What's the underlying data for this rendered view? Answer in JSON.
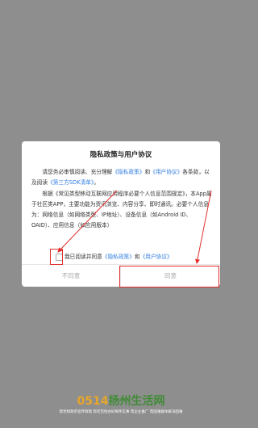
{
  "dialog": {
    "title": "隐私政策与用户协议",
    "body": {
      "p1_pre": "请您务必审慎阅读、充分理解",
      "p1_privacy": "《隐私政策》",
      "p1_and": "和",
      "p1_user": "《用户协议》",
      "p1_post": "各条款，以及阅读",
      "p1_sdk": "《第三方SDK清单》",
      "p1_end": "。",
      "p2": "根据《常见类型移动互联网应用程序必要个人信息范围规定》，本App属于社区类APP，主要功能为资讯浏览、内容分享、即时通讯。必要个人信息为：网络信息（如网络类型、IP地址）、设备信息（如Android ID、OAID）、应用信息（如应用版本）"
    },
    "consent": {
      "pre": "我已阅读并同意",
      "privacy": "《隐私政策》",
      "and": "和",
      "user": "《用户协议》"
    },
    "buttons": {
      "disagree": "不同意",
      "agree": "同意"
    }
  },
  "footer": {
    "brand_num": "0514",
    "brand_name": "扬州生活网",
    "tagline": "帮党和政府宣传政策 帮老百姓办好每件实事 帮企业推广 帮困难群体解决困难"
  },
  "colors": {
    "link": "#2f7de1",
    "highlight": "#e32c2c",
    "overlay": "#8e8e8e"
  }
}
